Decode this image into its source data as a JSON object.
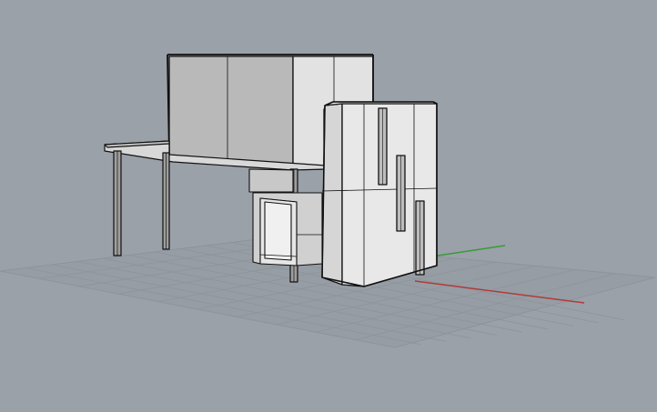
{
  "viewport": {
    "background": "#9aa1a8",
    "grid_color": "#8c939a",
    "grid_minor_color": "#949ba2",
    "x_axis_color": "#b23a3a",
    "y_axis_color": "#3a9a3a",
    "edge_color": "#111111",
    "light_face": "#e6e6e6",
    "mid_face": "#d4d4d4",
    "dark_face": "#b8b8b8"
  }
}
